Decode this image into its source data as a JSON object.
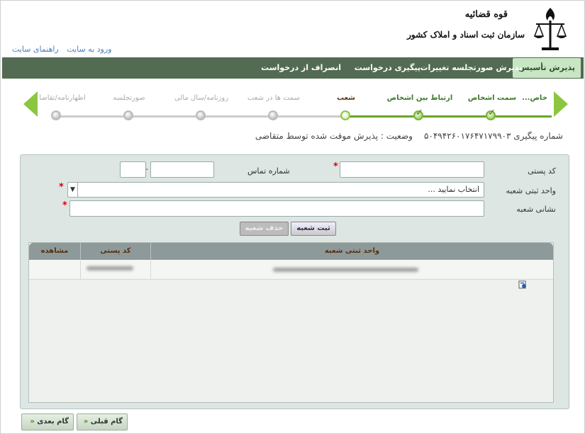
{
  "header": {
    "links": [
      "ورود به سایت",
      "راهنمای سایت"
    ],
    "logo_line1": "قوه قضائیه",
    "logo_line2": "سازمان ثبت اسناد و املاک کشور"
  },
  "navbar": {
    "items": [
      {
        "label": "پذیرش تأسیس",
        "active": true
      },
      {
        "label": "پذیرش صورتجلسه تغییرات",
        "active": false
      },
      {
        "label": "پیگیری درخواست",
        "active": false
      },
      {
        "label": "انصراف از درخواست",
        "active": false
      }
    ]
  },
  "stepper": {
    "steps": [
      {
        "label": "...خاص",
        "state": "done"
      },
      {
        "label": "سمت اشخاص",
        "state": "done"
      },
      {
        "label": "ارتباط بین اشخاص",
        "state": "done"
      },
      {
        "label": "شعب",
        "state": "current"
      },
      {
        "label": "سمت ها در شعب",
        "state": "pending"
      },
      {
        "label": "روزنامه/سال مالی",
        "state": "pending"
      },
      {
        "label": "صورتجلسه",
        "state": "pending"
      },
      {
        "label": "اظهارنامه/تقاضا",
        "state": "pending"
      }
    ]
  },
  "tracking": {
    "number_text": "شماره پیگیری ۵۰۴۹۴۲۶۰۱۷۶۴۷۱۷۹۹۰۳",
    "status_text": "وضعیت : پذیرش موقت شده توسط متقاضی"
  },
  "form": {
    "postal_code_label": "کد پستی",
    "phone_label": "شماره تماس",
    "branch_unit_label": "واحد ثبتی شعبه",
    "branch_unit_value": "انتخاب نمایید ...",
    "branch_address_label": "نشانی شعبه",
    "required_mark": "*",
    "phone_separator": "-",
    "add_button": "ثبت شعبه",
    "delete_button": "حذف شعبه"
  },
  "table": {
    "headers": [
      "واحد ثبتی شعبه",
      "کد پستی",
      "مشاهده"
    ]
  },
  "footer": {
    "prev_button": "گام قبلی",
    "next_button": "گام بعدی",
    "prev_arrow": "«",
    "next_arrow": "«"
  },
  "colors": {
    "navbar": "#526b52",
    "active_tab": "#c8e6c3",
    "step_done": "#8cc63f",
    "panel": "#dde6e3",
    "table_header": "#8e9a9a",
    "required": "#dd0000"
  }
}
